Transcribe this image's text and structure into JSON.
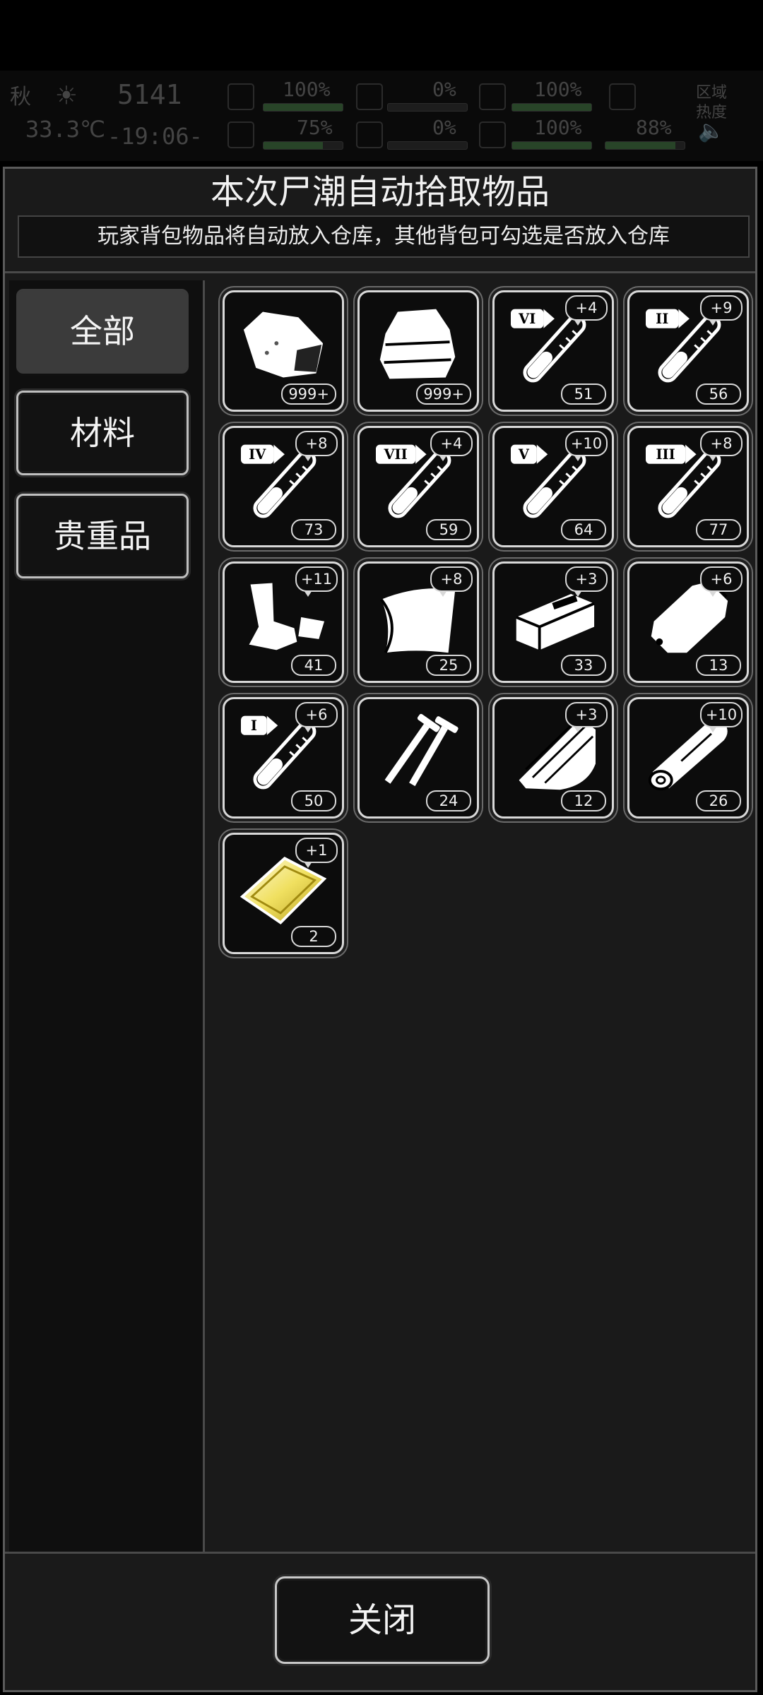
{
  "hud": {
    "season": "秋",
    "temperature": "33.3℃",
    "day": "5141",
    "clock": "-19:06-",
    "stats": [
      "100%",
      "0%",
      "100%",
      "75%",
      "0%",
      "100%",
      "88%"
    ],
    "region": "区域\n热度",
    "sun_icon": "sun-icon",
    "sound_icon": "speaker-icon"
  },
  "dialog": {
    "title": "本次尸潮自动拾取物品",
    "subtitle": "玩家背包物品将自动放入仓库，其他背包可勾选是否放入仓库",
    "close_label": "关闭"
  },
  "tabs": [
    {
      "label": "全部",
      "active": true
    },
    {
      "label": "材料",
      "active": false
    },
    {
      "label": "贵重品",
      "active": false
    }
  ],
  "items": [
    {
      "icon": "cloth-scrap-icon",
      "count": "999+",
      "bonus": ""
    },
    {
      "icon": "folded-cloth-icon",
      "count": "999+",
      "bonus": ""
    },
    {
      "icon": "test-tube-vi-icon",
      "tier": "VI",
      "count": "51",
      "bonus": "+4"
    },
    {
      "icon": "test-tube-ii-icon",
      "tier": "II",
      "count": "56",
      "bonus": "+9"
    },
    {
      "icon": "test-tube-iv-icon",
      "tier": "IV",
      "count": "73",
      "bonus": "+8"
    },
    {
      "icon": "test-tube-vii-icon",
      "tier": "VII",
      "count": "59",
      "bonus": "+4"
    },
    {
      "icon": "test-tube-v-icon",
      "tier": "V",
      "count": "64",
      "bonus": "+10"
    },
    {
      "icon": "test-tube-iii-icon",
      "tier": "III",
      "count": "77",
      "bonus": "+8"
    },
    {
      "icon": "scrap-parts-icon",
      "count": "41",
      "bonus": "+11"
    },
    {
      "icon": "leather-sheet-icon",
      "count": "25",
      "bonus": "+8"
    },
    {
      "icon": "wood-block-icon",
      "count": "33",
      "bonus": "+3"
    },
    {
      "icon": "plastic-bag-icon",
      "count": "13",
      "bonus": "+6"
    },
    {
      "icon": "test-tube-i-icon",
      "tier": "I",
      "count": "50",
      "bonus": "+6"
    },
    {
      "icon": "nails-icon",
      "count": "24",
      "bonus": ""
    },
    {
      "icon": "wood-planks-icon",
      "count": "12",
      "bonus": "+3"
    },
    {
      "icon": "log-icon",
      "count": "26",
      "bonus": "+10"
    },
    {
      "icon": "gold-bar-icon",
      "count": "2",
      "bonus": "+1"
    }
  ],
  "colors": {
    "panel_bg": "#1a1a1a",
    "sidebar_bg": "#0f0f0f",
    "active_tab": "#3b3b3b",
    "gold": "#e8d84a"
  }
}
